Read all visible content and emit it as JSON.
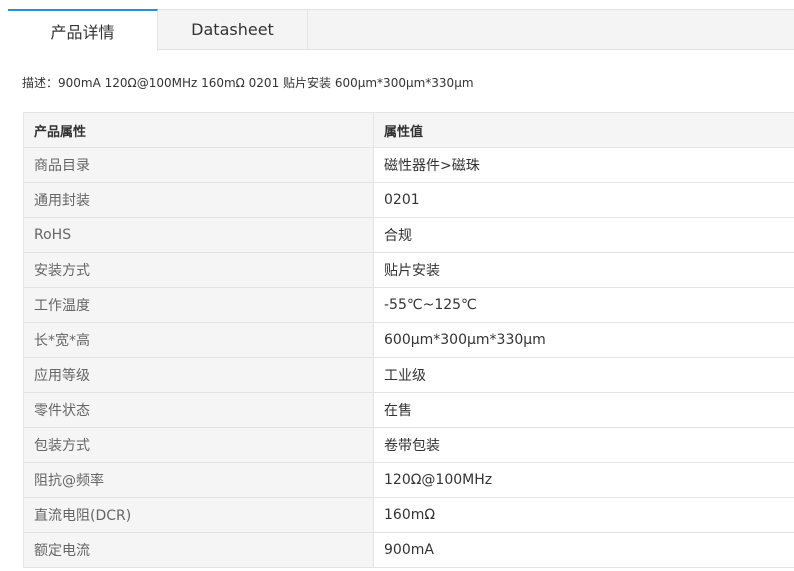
{
  "tabs": [
    {
      "label": "产品详情",
      "active": true
    },
    {
      "label": "Datasheet",
      "active": false
    }
  ],
  "description": "描述：900mA 120Ω@100MHz 160mΩ 0201 贴片安装 600μm*300μm*330μm",
  "table": {
    "headers": [
      "产品属性",
      "属性值"
    ],
    "rows": [
      [
        "商品目录",
        "磁性器件>磁珠"
      ],
      [
        "通用封装",
        "0201"
      ],
      [
        "RoHS",
        "合规"
      ],
      [
        "安装方式",
        "贴片安装"
      ],
      [
        "工作温度",
        "-55℃~125℃"
      ],
      [
        "长*宽*高",
        "600μm*300μm*330μm"
      ],
      [
        "应用等级",
        "工业级"
      ],
      [
        "零件状态",
        "在售"
      ],
      [
        "包装方式",
        "卷带包装"
      ],
      [
        "阻抗@频率",
        "120Ω@100MHz"
      ],
      [
        "直流电阻(DCR)",
        "160mΩ"
      ],
      [
        "额定电流",
        "900mA"
      ]
    ]
  },
  "colors": {
    "accent": "#2a8fd6",
    "border": "#e4e4e4",
    "header_bg": "#f5f5f5"
  }
}
